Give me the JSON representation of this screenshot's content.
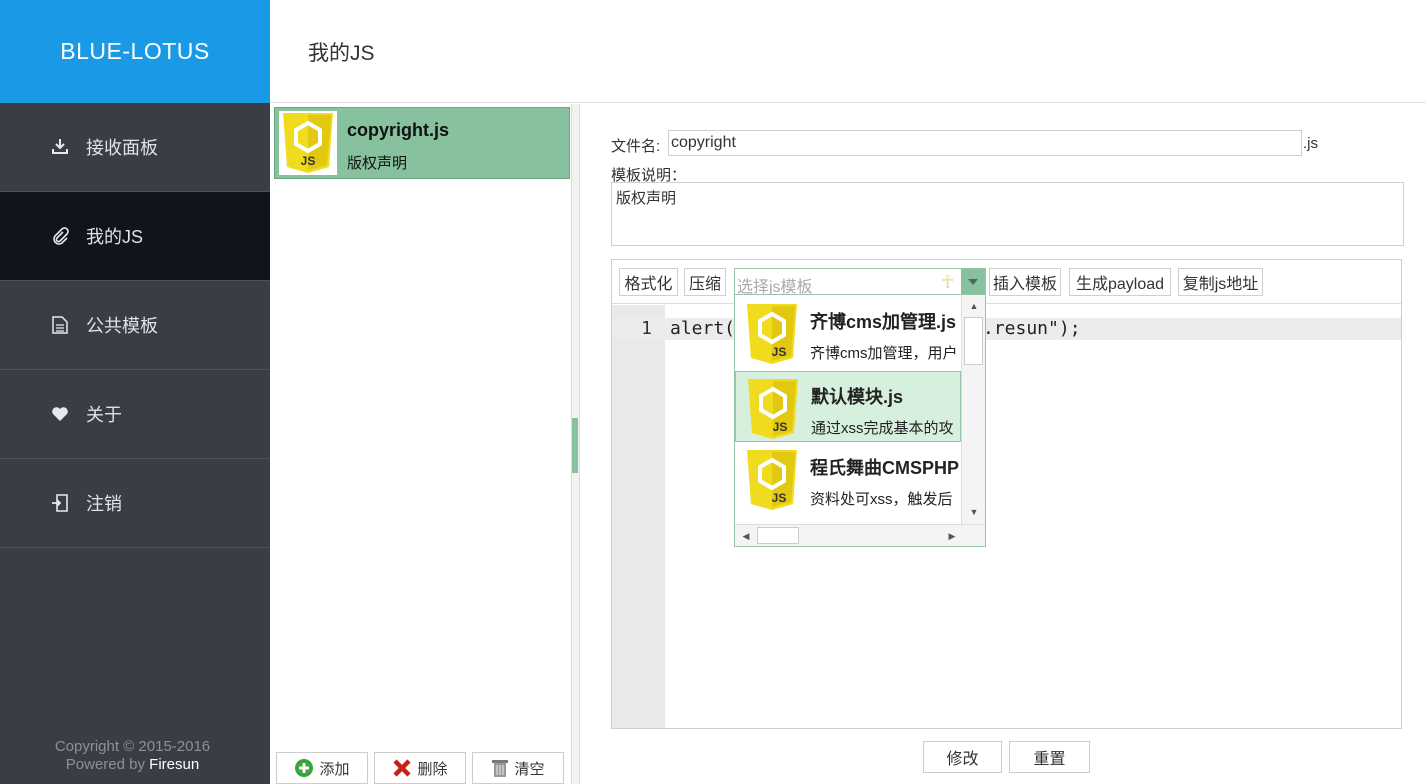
{
  "app": {
    "brand": "BLUE-LOTUS"
  },
  "sidebar": {
    "items": [
      {
        "label": "接收面板",
        "icon": "download-icon"
      },
      {
        "label": "我的JS",
        "icon": "paperclip-icon",
        "active": true
      },
      {
        "label": "公共模板",
        "icon": "document-icon"
      },
      {
        "label": "关于",
        "icon": "heart-icon"
      },
      {
        "label": "注销",
        "icon": "logout-icon"
      }
    ],
    "footer": {
      "copyright": "Copyright © 2015-2016",
      "powered_prefix": "Powered by",
      "powered_name": "Firesun"
    }
  },
  "header": {
    "title": "我的JS"
  },
  "file_list": {
    "items": [
      {
        "name": "copyright.js",
        "description": "版权声明",
        "icon_text": "JS"
      }
    ],
    "buttons": {
      "add": "添加",
      "delete": "删除",
      "clear": "清空"
    }
  },
  "form": {
    "filename_label": "文件名:",
    "filename_value": "copyright",
    "filename_suffix": ".js",
    "description_label": "模板说明：",
    "description_value": "版权声明"
  },
  "editor": {
    "toolbar": {
      "format": "格式化",
      "compress": "压缩",
      "template_placeholder": "选择js模板",
      "ankh_glyph": "☥",
      "insert": "插入模板",
      "payload": "生成payload",
      "copy_url": "复制js地址"
    },
    "lines": [
      {
        "number": "1",
        "code_start": "alert(",
        "code_end": ".resun\");"
      }
    ]
  },
  "dropdown": {
    "items": [
      {
        "title": "齐博cms加管理.js",
        "description": "齐博cms加管理，用户",
        "icon_text": "JS"
      },
      {
        "title": "默认模块.js",
        "description": "通过xss完成基本的攻",
        "icon_text": "JS",
        "selected": true
      },
      {
        "title": "程氏舞曲CMSPHP",
        "description": "资料处可xss，触发后",
        "icon_text": "JS"
      }
    ]
  },
  "actions": {
    "modify": "修改",
    "reset": "重置"
  },
  "colors": {
    "brand_blue": "#1a9ae6",
    "accent_green": "#88c19e",
    "sidebar_bg": "#393d46",
    "js_yellow": "#f0db1e"
  }
}
